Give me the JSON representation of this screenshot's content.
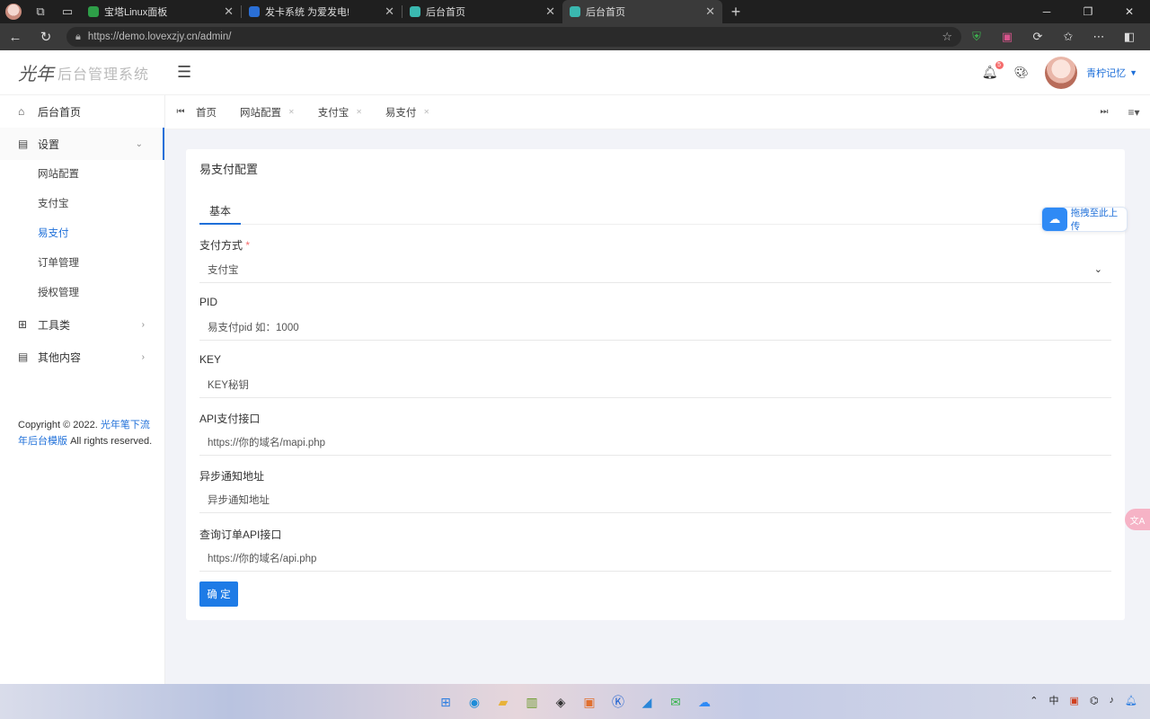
{
  "browser": {
    "tabs": [
      {
        "title": "宝塔Linux面板",
        "favicon_color": "#2e9e48",
        "active": false
      },
      {
        "title": "发卡系统 为爱发电!",
        "favicon_color": "#2a6fd6",
        "active": false
      },
      {
        "title": "后台首页",
        "favicon_color": "#3ab8b0",
        "active": false
      },
      {
        "title": "后台首页",
        "favicon_color": "#3ab8b0",
        "active": true
      }
    ],
    "url": "https://demo.lovexzjy.cn/admin/"
  },
  "header": {
    "logo_mark": "光年",
    "logo_text": "后台管理系统",
    "notification_count": "5",
    "username": "青柠记忆"
  },
  "sidebar": {
    "items": [
      {
        "label": "后台首页",
        "icon": "home-icon",
        "has_children": false
      },
      {
        "label": "设置",
        "icon": "settings-icon",
        "has_children": true,
        "open": true
      },
      {
        "label": "工具类",
        "icon": "tools-icon",
        "has_children": true
      },
      {
        "label": "其他内容",
        "icon": "content-icon",
        "has_children": true
      }
    ],
    "submenu": [
      {
        "label": "网站配置",
        "active": false
      },
      {
        "label": "支付宝",
        "active": false
      },
      {
        "label": "易支付",
        "active": true
      },
      {
        "label": "订单管理",
        "active": false
      },
      {
        "label": "授权管理",
        "active": false
      }
    ],
    "copyright_prefix": "Copyright © 2022.",
    "copyright_link": "光年笔下流  年后台模版",
    "copyright_suffix": "All rights reserved."
  },
  "tagbar": {
    "tags": [
      "首页",
      "网站配置",
      "支付宝",
      "易支付"
    ]
  },
  "card": {
    "title": "易支付配置",
    "tab_label": "基本",
    "fields": [
      {
        "label": "支付方式",
        "required": "*",
        "type": "select",
        "value": "支付宝"
      },
      {
        "label": "PID",
        "type": "input",
        "placeholder": "易支付pid 如：1000"
      },
      {
        "label": "KEY",
        "type": "input",
        "placeholder": "KEY秘钥"
      },
      {
        "label": "API支付接口",
        "type": "input",
        "placeholder": "https://你的域名/mapi.php"
      },
      {
        "label": "异步通知地址",
        "type": "input",
        "placeholder": "异步通知地址"
      },
      {
        "label": "查询订单API接口",
        "type": "input",
        "placeholder": "https://你的域名/api.php"
      }
    ],
    "confirm_label": "确 定"
  },
  "floats": {
    "upload_label": "拖拽至此上传",
    "translate_label": "文A"
  },
  "taskbar": {
    "ime": "中"
  }
}
